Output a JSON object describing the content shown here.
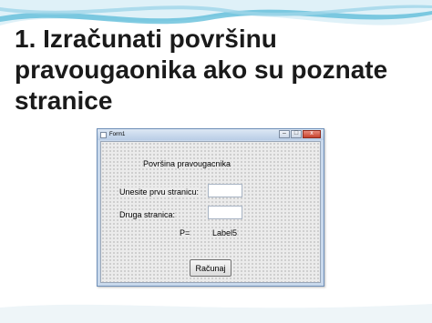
{
  "slide": {
    "title_number": "1.",
    "title_text": "Izračunati površinu pravougaonika ako su poznate stranice"
  },
  "window": {
    "title": "Form1",
    "controls": {
      "minimize": "–",
      "maximize": "□",
      "close": "x"
    }
  },
  "form": {
    "heading": "Površina pravougacnika",
    "label_first_side": "Unesite prvu stranicu:",
    "label_second_side": "Druga stranica:",
    "first_side_value": "",
    "second_side_value": "",
    "result_prefix": "P=",
    "result_label": "Label5",
    "calc_button": "Računaj"
  },
  "colors": {
    "slide_wave_light": "#dff1f8",
    "slide_wave_accent": "#4fb6d6",
    "window_frame": "#c9d9ec",
    "form_background": "#ebebeb"
  }
}
